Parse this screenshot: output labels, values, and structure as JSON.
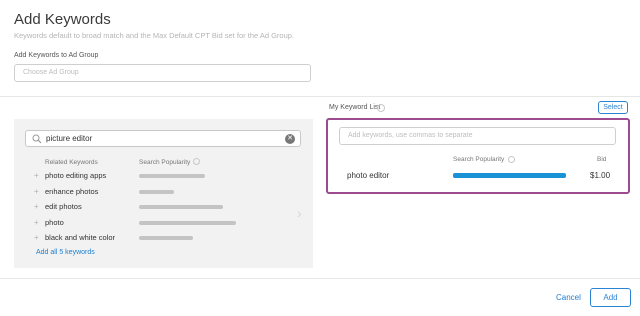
{
  "header": {
    "title": "Add Keywords",
    "subtitle": "Keywords default to broad match and the Max Default CPT Bid set for the Ad Group."
  },
  "ad_group": {
    "label": "Add Keywords to Ad Group",
    "placeholder": "Choose Ad Group"
  },
  "search": {
    "value": "picture editor",
    "clear_icon": "close-circle-icon"
  },
  "related": {
    "col_keywords": "Related Keywords",
    "col_popularity": "Search Popularity",
    "plus_glyph": "+",
    "items": [
      {
        "label": "photo editing apps",
        "popularity": 0.66
      },
      {
        "label": "enhance photos",
        "popularity": 0.35
      },
      {
        "label": "edit photos",
        "popularity": 0.84
      },
      {
        "label": "photo",
        "popularity": 0.97
      },
      {
        "label": "black and white color",
        "popularity": 0.54
      }
    ],
    "add_all": "Add all 5 keywords"
  },
  "my_list": {
    "label": "My Keyword List",
    "select_label": "Select",
    "input_placeholder": "Add keywords, use commas to separate",
    "col_popularity": "Search Popularity",
    "col_bid": "Bid",
    "items": [
      {
        "label": "photo editor",
        "popularity": 1.0,
        "bid": "$1.00"
      }
    ],
    "highlight_color": "#9c4b8f",
    "popularity_color": "#1a92d6"
  },
  "footer": {
    "cancel_label": "Cancel",
    "add_label": "Add"
  }
}
